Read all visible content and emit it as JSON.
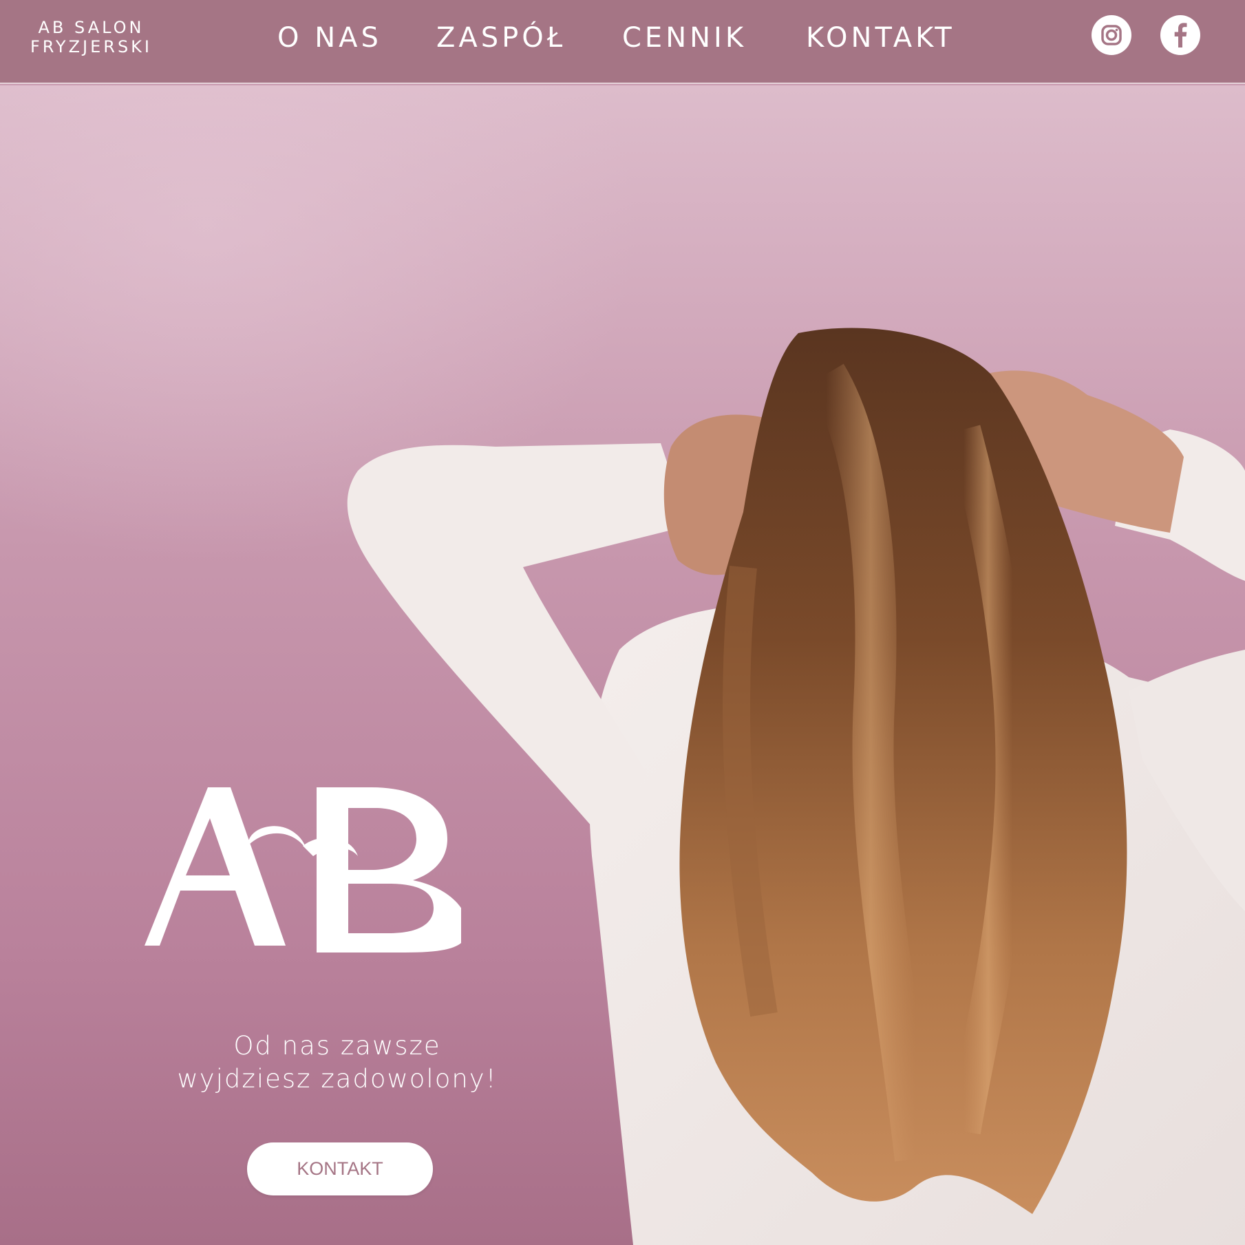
{
  "brand": {
    "line1": "AB SALON",
    "line2": "FRYZJERSKI"
  },
  "nav": {
    "items": [
      {
        "label": "O NAS"
      },
      {
        "label": "ZASPÓŁ"
      },
      {
        "label": "CENNIK"
      },
      {
        "label": "KONTAKT"
      }
    ]
  },
  "social": {
    "instagram_icon": "instagram-icon",
    "facebook_icon": "facebook-icon"
  },
  "hero": {
    "logo_text": "AB",
    "tagline_line1": "Od nas zawsze",
    "tagline_line2": "wyjdziesz zadowolony!",
    "cta_label": "KONTAKT"
  },
  "colors": {
    "header_bg": "#a57585",
    "accent": "#a57585",
    "text_light": "#ffffff"
  }
}
